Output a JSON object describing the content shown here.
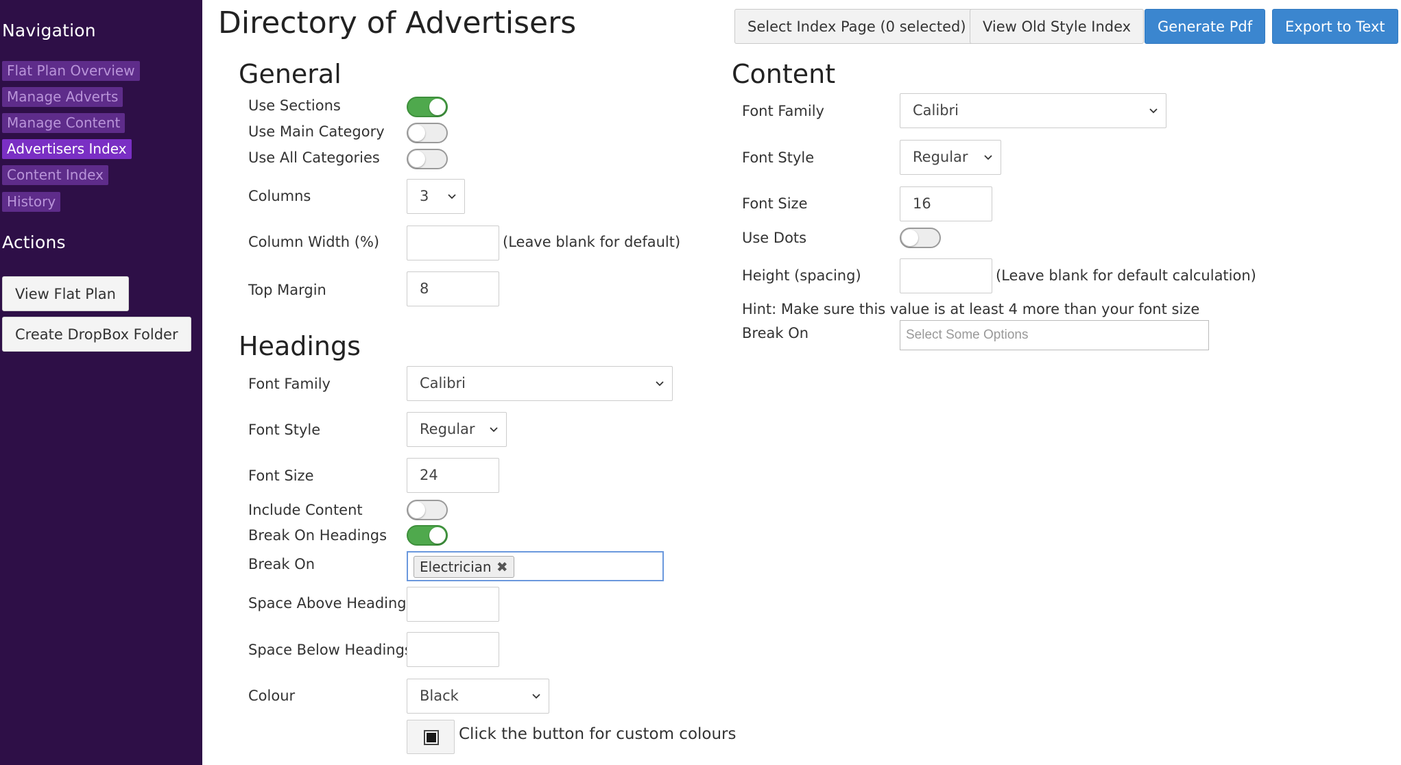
{
  "sidebar": {
    "navigation_heading": "Navigation",
    "nav_items": [
      {
        "label": "Flat Plan Overview",
        "active": false
      },
      {
        "label": "Manage Adverts",
        "active": false
      },
      {
        "label": "Manage Content",
        "active": false
      },
      {
        "label": "Advertisers Index",
        "active": true
      },
      {
        "label": "Content Index",
        "active": false
      },
      {
        "label": "History",
        "active": false
      }
    ],
    "actions_heading": "Actions",
    "actions": [
      "View Flat Plan",
      "Create DropBox Folder"
    ]
  },
  "header": {
    "title": "Directory of Advertisers",
    "buttons": [
      "Select Index Page (0 selected)",
      "View Old Style Index",
      "Generate Pdf",
      "Export to Text"
    ]
  },
  "general": {
    "title": "General",
    "use_sections": {
      "label": "Use Sections",
      "on": true
    },
    "use_main_category": {
      "label": "Use Main Category",
      "on": false
    },
    "use_all_categories": {
      "label": "Use All Categories",
      "on": false
    },
    "columns": {
      "label": "Columns",
      "value": "3"
    },
    "column_width": {
      "label": "Column Width (%)",
      "value": "",
      "hint": "(Leave blank for default)"
    },
    "top_margin": {
      "label": "Top Margin",
      "value": "8"
    }
  },
  "headings": {
    "title": "Headings",
    "font_family": {
      "label": "Font Family",
      "value": "Calibri"
    },
    "font_style": {
      "label": "Font Style",
      "value": "Regular"
    },
    "font_size": {
      "label": "Font Size",
      "value": "24"
    },
    "include_content": {
      "label": "Include Content",
      "on": false
    },
    "break_on_headings": {
      "label": "Break On Headings",
      "on": true
    },
    "break_on": {
      "label": "Break On",
      "chips": [
        "Electrician"
      ]
    },
    "space_above": {
      "label": "Space Above Headings",
      "value": ""
    },
    "space_below": {
      "label": "Space Below Headings",
      "value": ""
    },
    "colour": {
      "label": "Colour",
      "value": "Black",
      "custom_hint": "Click the button for custom colours"
    }
  },
  "content": {
    "title": "Content",
    "font_family": {
      "label": "Font Family",
      "value": "Calibri"
    },
    "font_style": {
      "label": "Font Style",
      "value": "Regular"
    },
    "font_size": {
      "label": "Font Size",
      "value": "16"
    },
    "use_dots": {
      "label": "Use Dots",
      "on": false
    },
    "height_spacing": {
      "label": "Height (spacing)",
      "value": "",
      "hint": "(Leave blank for default calculation)"
    },
    "hint": "Hint: Make sure this value is at least 4 more than your font size",
    "break_on": {
      "label": "Break On",
      "placeholder": "Select Some Options"
    }
  },
  "colors": {
    "sidebar_bg": "#2e0f47",
    "nav_item_bg": "#5e2c8a",
    "nav_item_active_bg": "#7a2fc4",
    "primary_button": "#3b86cf",
    "toggle_on": "#4fa94d"
  }
}
